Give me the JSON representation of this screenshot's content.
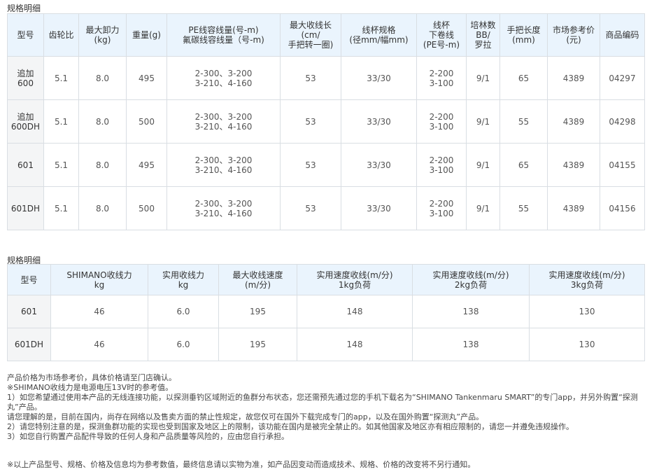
{
  "section1": {
    "title": "规格明细",
    "headers": [
      [
        "型号"
      ],
      [
        "齿轮比"
      ],
      [
        "最大卸力",
        "(kg)"
      ],
      [
        "重量(g)"
      ],
      [
        "PE线容线量(号-m)",
        "氟碳线容线量（号-m)"
      ],
      [
        "最大收线长",
        "(cm/",
        "手把转一圈)"
      ],
      [
        "线杯规格",
        "(径mm/幅mm)"
      ],
      [
        "线杯",
        "下卷线",
        "(PE号-m)"
      ],
      [
        "培林数",
        "BB/",
        "罗拉"
      ],
      [
        "手把长度",
        "(mm)"
      ],
      [
        "市场参考价",
        "(元)"
      ],
      [
        "商品编码"
      ]
    ],
    "rows": [
      [
        [
          "追加",
          "600"
        ],
        [
          "5.1"
        ],
        [
          "8.0"
        ],
        [
          "495"
        ],
        [
          "2-300、3-200",
          "3-210、4-160"
        ],
        [
          "53"
        ],
        [
          "33/30"
        ],
        [
          "2-200",
          "3-100"
        ],
        [
          "9/1"
        ],
        [
          "65"
        ],
        [
          "4389"
        ],
        [
          "04297"
        ]
      ],
      [
        [
          "追加",
          "600DH"
        ],
        [
          "5.1"
        ],
        [
          "8.0"
        ],
        [
          "500"
        ],
        [
          "2-300、3-200",
          "3-210、4-160"
        ],
        [
          "53"
        ],
        [
          "33/30"
        ],
        [
          "2-200",
          "3-100"
        ],
        [
          "9/1"
        ],
        [
          "55"
        ],
        [
          "4389"
        ],
        [
          "04298"
        ]
      ],
      [
        [
          "601"
        ],
        [
          "5.1"
        ],
        [
          "8.0"
        ],
        [
          "495"
        ],
        [
          "2-300、3-200",
          "3-210、4-160"
        ],
        [
          "53"
        ],
        [
          "33/30"
        ],
        [
          "2-200",
          "3-100"
        ],
        [
          "9/1"
        ],
        [
          "65"
        ],
        [
          "4389"
        ],
        [
          "04155"
        ]
      ],
      [
        [
          "601DH"
        ],
        [
          "5.1"
        ],
        [
          "8.0"
        ],
        [
          "500"
        ],
        [
          "2-300、3-200",
          "3-210、4-160"
        ],
        [
          "53"
        ],
        [
          "33/30"
        ],
        [
          "2-200",
          "3-100"
        ],
        [
          "9/1"
        ],
        [
          "55"
        ],
        [
          "4389"
        ],
        [
          "04156"
        ]
      ]
    ]
  },
  "section2": {
    "title": "规格明细",
    "headers": [
      [
        "型号"
      ],
      [
        "SHIMANO收线力",
        "kg"
      ],
      [
        "实用收线力",
        "kg"
      ],
      [
        "最大收线速度",
        "(m/分)"
      ],
      [
        "实用速度收线(m/分)",
        "1kg负荷"
      ],
      [
        "实用速度收线(m/分)",
        "2kg负荷"
      ],
      [
        "实用速度收线(m/分)",
        "3kg负荷"
      ]
    ],
    "rows": [
      [
        [
          "601"
        ],
        [
          "46"
        ],
        [
          "6.0"
        ],
        [
          "195"
        ],
        [
          "148"
        ],
        [
          "138"
        ],
        [
          "130"
        ]
      ],
      [
        [
          "601DH"
        ],
        [
          "46"
        ],
        [
          "6.0"
        ],
        [
          "195"
        ],
        [
          "148"
        ],
        [
          "138"
        ],
        [
          "130"
        ]
      ]
    ]
  },
  "notes": [
    "产品价格为市场参考价，具体价格请至门店确认。",
    "※SHIMANO收线力是电源电压13V时的参考值。",
    "1）如您希望通过使用本产品的无线连接功能，以探测垂钓区域附近的鱼群分布状态，您还需预先通过您的手机下载名为“SHIMANO Tankenmaru SMART”的专门app，并另外购置“探测丸”产品。",
    "请您理解的是，目前在国内，尚存在网络以及售卖方面的禁止性规定，故您仅可在国外下载完成专门的app，以及在国外购置“探测丸”产品。",
    "2）请您特别注意的是，探测鱼群功能的实现也受到国家及地区上的限制，该功能在国内是被完全禁止的。如其他国家及地区亦有相应限制的，请您一并遵免违规操作。",
    "3）如您自行购置产品配件导致的任何人身和产品质量等风险的，应由您自行承担。"
  ],
  "footnote": "※以上产品型号、规格、价格及信息均为参考数值，最终信息请以实物为准，如产品因变动而造成技术、规格、价格的改变将不另行通知。"
}
